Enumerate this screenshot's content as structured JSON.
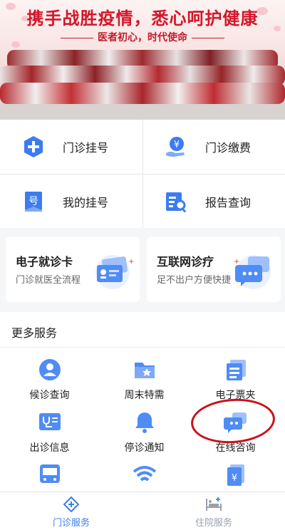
{
  "banner": {
    "title": "携手战胜疫情，悉心呵护健康",
    "subtitle": "医者初心，时代使命"
  },
  "quick_actions": [
    {
      "label": "门诊挂号",
      "icon": "plus-circle-icon"
    },
    {
      "label": "门诊缴费",
      "icon": "yen-hand-icon"
    },
    {
      "label": "我的挂号",
      "icon": "number-ticket-icon"
    },
    {
      "label": "报告查询",
      "icon": "report-search-icon"
    }
  ],
  "cards": [
    {
      "title": "电子就诊卡",
      "subtitle": "门诊就医全流程",
      "icon": "id-card-icon"
    },
    {
      "title": "互联网诊疗",
      "subtitle": "足不出户方便快捷",
      "icon": "chat-bubble-icon"
    }
  ],
  "more_services": {
    "title": "更多服务",
    "items": [
      {
        "label": "候诊查询",
        "icon": "user-circle-icon"
      },
      {
        "label": "周末特需",
        "icon": "folder-icon"
      },
      {
        "label": "电子票夹",
        "icon": "ticket-stack-icon"
      },
      {
        "label": "出诊信息",
        "icon": "stethoscope-icon"
      },
      {
        "label": "停诊通知",
        "icon": "bell-icon"
      },
      {
        "label": "在线咨询",
        "icon": "chat-icon"
      },
      {
        "label": "",
        "icon": "bus-icon"
      },
      {
        "label": "",
        "icon": "wifi-icon"
      },
      {
        "label": "",
        "icon": "receipt-icon"
      }
    ]
  },
  "tabbar": [
    {
      "label": "门诊服务",
      "icon": "outpatient-icon",
      "active": true
    },
    {
      "label": "住院服务",
      "icon": "hospital-bed-icon",
      "active": false
    }
  ],
  "colors": {
    "accent": "#3b7cf0",
    "banner_red": "#d3162a",
    "annotation_red": "#c8121a",
    "active_tab": "#3b7cf0",
    "inactive_tab": "#9aa1ac"
  }
}
